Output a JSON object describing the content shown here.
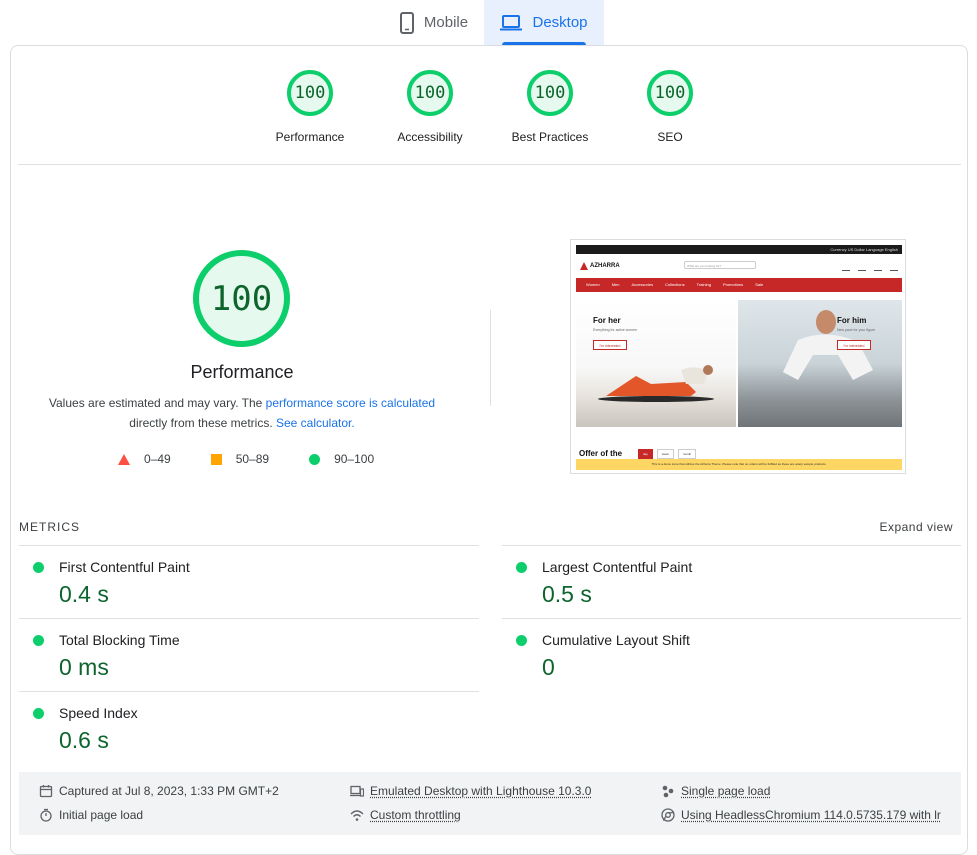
{
  "tabs": {
    "mobile": "Mobile",
    "desktop": "Desktop",
    "active": "Desktop"
  },
  "scores": [
    {
      "label": "Performance",
      "value": "100"
    },
    {
      "label": "Accessibility",
      "value": "100"
    },
    {
      "label": "Best Practices",
      "value": "100"
    },
    {
      "label": "SEO",
      "value": "100"
    }
  ],
  "performance": {
    "score": "100",
    "title": "Performance",
    "desc_1": "Values are estimated and may vary. The ",
    "desc_link_1": "performance score is calculated",
    "desc_2": "directly from these metrics. ",
    "desc_link_2": "See calculator.",
    "legend": {
      "fail": "0–49",
      "average": "50–89",
      "pass": "90–100"
    }
  },
  "thumbnail": {
    "topbar": "Currency US Dollar   Language English",
    "logo": "AZHARRA",
    "search_placeholder": "What are you looking for?",
    "nav": [
      "Women",
      "Men",
      "Accessories",
      "Collections",
      "Training",
      "Promotions",
      "Sale"
    ],
    "hero_left_title": "For her",
    "hero_left_sub": "Everything for active women",
    "hero_left_btn": "I'm interested",
    "hero_right_title": "For him",
    "hero_right_sub": "New pace for your figure",
    "hero_right_btn": "I'm interested",
    "offer_title": "Offer of the",
    "offer_tabs": [
      "day",
      "week",
      "month"
    ],
    "banner": "This is a demo store that utilizes the Azharra Theme. Please note that no orders will be fulfilled as these are solely sample products."
  },
  "metrics": {
    "section_label": "METRICS",
    "expand_label": "Expand view",
    "items": [
      {
        "name": "First Contentful Paint",
        "value": "0.4 s"
      },
      {
        "name": "Largest Contentful Paint",
        "value": "0.5 s"
      },
      {
        "name": "Total Blocking Time",
        "value": "0 ms"
      },
      {
        "name": "Cumulative Layout Shift",
        "value": "0"
      },
      {
        "name": "Speed Index",
        "value": "0.6 s"
      }
    ]
  },
  "footer": {
    "captured": "Captured at Jul 8, 2023, 1:33 PM GMT+2",
    "initial_load": "Initial page load",
    "emulated": "Emulated Desktop with Lighthouse 10.3.0",
    "throttling": "Custom throttling",
    "single_page": "Single page load",
    "chromium": "Using HeadlessChromium 114.0.5735.179 with lr"
  },
  "colors": {
    "pass": "#0cce6b",
    "pass_text": "#0d652d",
    "average": "#ffa400",
    "fail": "#ff4e42",
    "link": "#1a73e8"
  }
}
